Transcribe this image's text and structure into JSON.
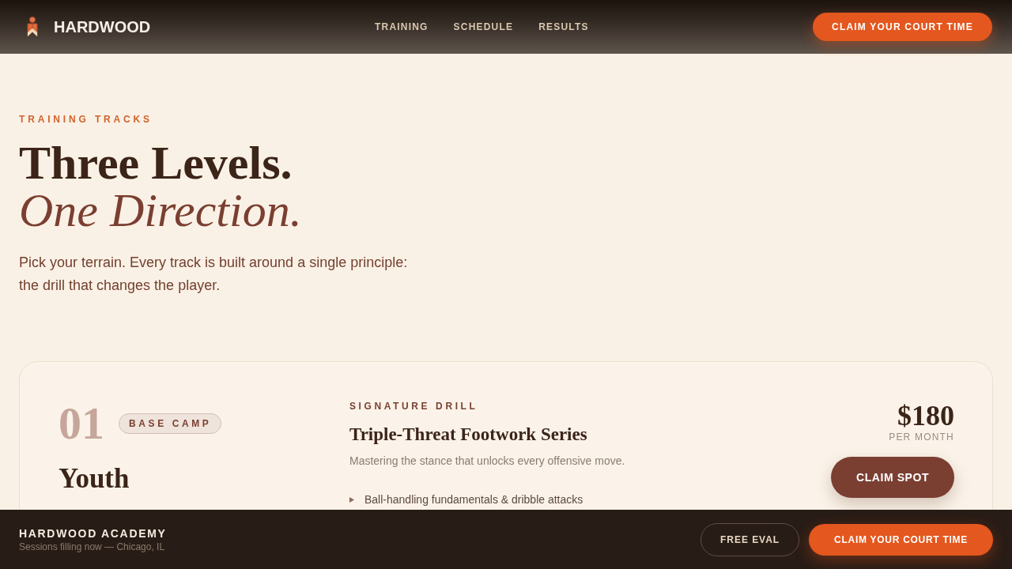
{
  "header": {
    "logo": "HARDWOOD",
    "nav": [
      {
        "label": "TRAINING"
      },
      {
        "label": "SCHEDULE"
      },
      {
        "label": "RESULTS"
      }
    ],
    "cta": "CLAIM YOUR COURT TIME"
  },
  "hero": {
    "eyebrow": "TRAINING TRACKS",
    "title": "Three Levels.",
    "title_accent": "One Direction.",
    "intro": "Pick your terrain. Every track is built around a single principle: the drill that changes the player."
  },
  "tracks": [
    {
      "number": "01",
      "badge": "BASE CAMP",
      "title": "Youth",
      "drill_label": "SIGNATURE DRILL",
      "drill_title": "Triple-Threat Footwork Series",
      "drill_description": "Mastering the stance that unlocks every offensive move.",
      "features": [
        "Ball-handling fundamentals & dribble attacks"
      ],
      "price": "$180",
      "price_period": "PER MONTH",
      "button": "CLAIM SPOT"
    }
  ],
  "bottom_bar": {
    "title": "HARDWOOD ACADEMY",
    "subtitle": "Sessions filling now — Chicago, IL",
    "buttons": [
      {
        "label": "FREE EVAL",
        "kind": "outline"
      },
      {
        "label": "CLAIM YOUR COURT TIME",
        "kind": "primary"
      }
    ]
  }
}
